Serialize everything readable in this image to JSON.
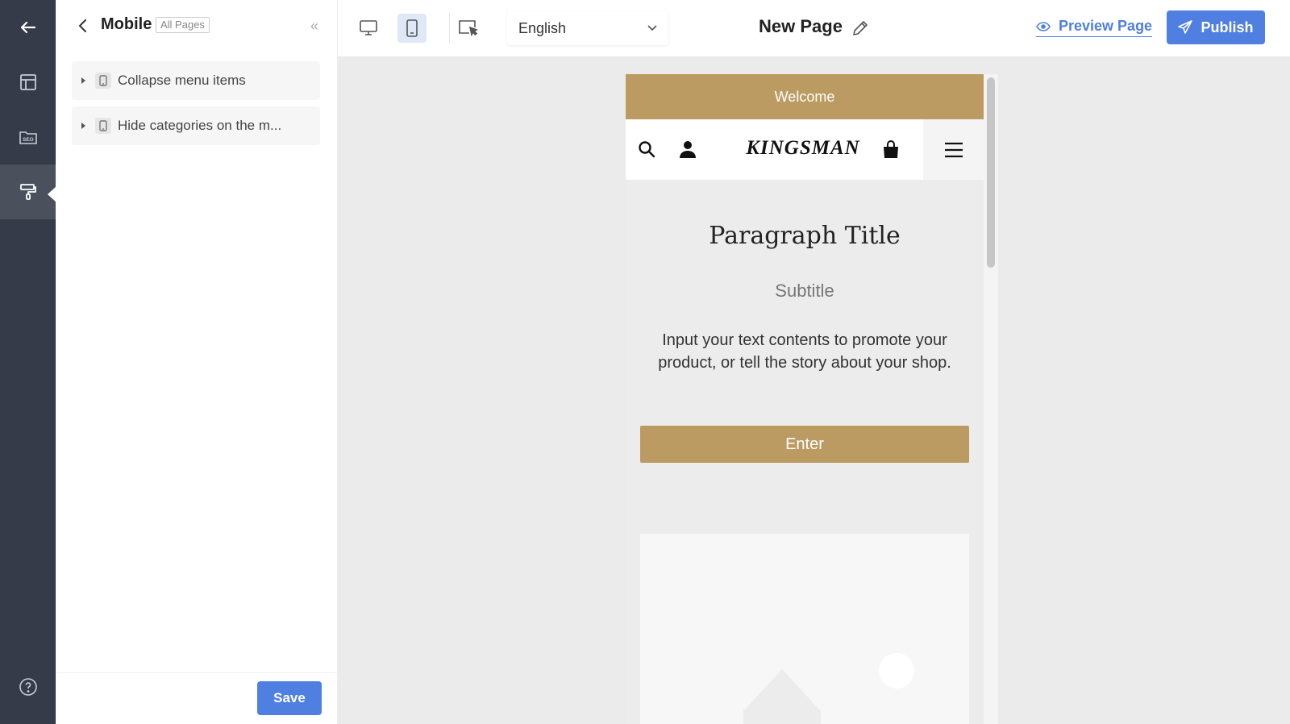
{
  "rail": {
    "items": [
      {
        "icon": "arrow-left-icon"
      },
      {
        "icon": "layout-icon"
      },
      {
        "icon": "seo-folder-icon",
        "label": "SEO"
      },
      {
        "icon": "paint-roller-icon"
      },
      {
        "icon": "help-circle-icon"
      }
    ]
  },
  "panel": {
    "title": "Mobile",
    "scope_tag": "All Pages",
    "collapse_label": "«",
    "items": [
      {
        "label": "Collapse menu items"
      },
      {
        "label": "Hide categories on the m..."
      }
    ],
    "save_label": "Save"
  },
  "topbar": {
    "language": "English",
    "page_title": "New Page",
    "preview_label": "Preview Page",
    "publish_label": "Publish"
  },
  "preview": {
    "welcome": "Welcome",
    "brand": "KINGSMAN",
    "paragraph_title": "Paragraph Title",
    "subtitle": "Subtitle",
    "body": "Input your text contents to promote your product, or tell the story about your shop.",
    "button_label": "Enter"
  },
  "colors": {
    "rail_bg": "#353b48",
    "accent_blue": "#4f7fe0",
    "brand_gold": "#bb9b62",
    "canvas_bg": "#ebebeb"
  }
}
